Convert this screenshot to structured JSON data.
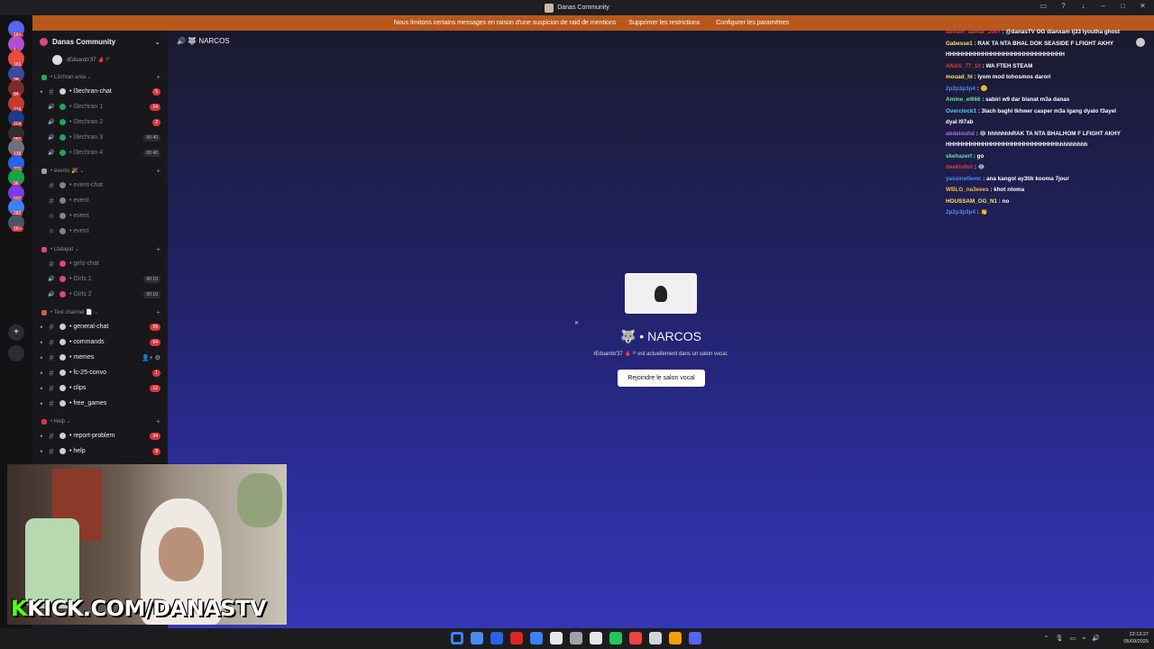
{
  "window": {
    "title": "Danas Community"
  },
  "banner": {
    "message": "Nous limitons certains messages en raison d'une suspicion de raid de mentions",
    "btn_remove": "Supprimer les restrictions",
    "btn_configure": "Configurer les paramètres"
  },
  "rail_badges": [
    "1K+",
    "1",
    "165",
    "38",
    "84",
    "210",
    "114",
    "267",
    "138",
    "721",
    "96",
    "507",
    "282",
    "1K+"
  ],
  "sidebar": {
    "server_name": "Danas Community",
    "voice_user": "ℓEduardo'37 🩸 ³⁷",
    "categories": [
      {
        "name": "L3chran area",
        "channels": [
          {
            "name": "l3echran-chat",
            "type": "text",
            "unread": true,
            "count": "5"
          },
          {
            "name": "l3echran 1",
            "type": "voice",
            "count": "14"
          },
          {
            "name": "l3echran 2",
            "type": "voice",
            "count": "2"
          },
          {
            "name": "l3echran 3",
            "type": "voice",
            "occ": "00 40"
          },
          {
            "name": "l3echran 4",
            "type": "voice",
            "occ": "00 40"
          }
        ]
      },
      {
        "name": "events 🎉",
        "channels": [
          {
            "name": "event-chat",
            "type": "text"
          },
          {
            "name": "event",
            "type": "text"
          },
          {
            "name": "event",
            "type": "stage"
          },
          {
            "name": "event",
            "type": "stage"
          }
        ]
      },
      {
        "name": "Lfatayat",
        "channels": [
          {
            "name": "girls-chat",
            "type": "text"
          },
          {
            "name": "Girls 1",
            "type": "voice",
            "occ": "00 10"
          },
          {
            "name": "Girls 2",
            "type": "voice",
            "occ": "00 10"
          }
        ]
      },
      {
        "name": "Text channel 📄",
        "channels": [
          {
            "name": "general-chat",
            "type": "text",
            "unread": true,
            "count": "99"
          },
          {
            "name": "commands",
            "type": "text",
            "unread": true,
            "count": "64"
          },
          {
            "name": "memes",
            "type": "text",
            "unread": true,
            "tools": "👤+ ⚙"
          },
          {
            "name": "fc-25-convo",
            "type": "text",
            "unread": true,
            "count": "1"
          },
          {
            "name": "clips",
            "type": "text",
            "unread": true,
            "count": "12"
          },
          {
            "name": "free_games",
            "type": "text",
            "unread": true
          }
        ]
      },
      {
        "name": "Help",
        "channels": [
          {
            "name": "report-problem",
            "type": "text",
            "unread": true,
            "count": "34"
          },
          {
            "name": "help",
            "type": "text",
            "unread": true,
            "count": "8"
          }
        ]
      }
    ]
  },
  "main": {
    "channel_title": "NARCOS",
    "voice_name": "NARCOS",
    "voice_sub": "ℓEduardo'37 🩸 ³⁷ est actuellement dans un salon vocal.",
    "join_label": "Rejoindre le salon vocal"
  },
  "chat": [
    {
      "user": "aboubr_aamar_2007",
      "color": "#e23b3b",
      "text": ": @danasTV OG dianxam ij33 lyoutha ghost"
    },
    {
      "user": "Gabesse1",
      "color": "#f5e663",
      "text": ": RAK TA NTA BHAL DOK SEASIDE F LFIGHT AKHY HHHHHHHHHHHHHHHHHHHHHHHHHHHHH"
    },
    {
      "user": "ANAS_77_10",
      "color": "#e23b3b",
      "text": ": WA FTEH STEAM"
    },
    {
      "user": "mouad_hl",
      "color": "#f5e663",
      "text": ": lyom mod tohosmos darori"
    },
    {
      "user": "2p2p3p3p4",
      "color": "#4c8ef5",
      "text": ": 🙂"
    },
    {
      "user": "Amine_el666",
      "color": "#6fe0a0",
      "text": ": sabiri w9 dar blanat m3a danas"
    },
    {
      "user": "Overclock1",
      "color": "#5fd1f0",
      "text": ": 3lach baghi tkhwer casper m3a lgang dyalo f3ayel dyal l97ab"
    },
    {
      "user": "abdelouhd",
      "color": "#b06cf0",
      "text": ": 😂 hhhhhhhRAK TA NTA BHALHOM F LFIGHT AKHY HHHHHHHHHHHHHHHHHHHHHHHHHHHhhhhhhhhh"
    },
    {
      "user": "skehazert",
      "color": "#6fe0a0",
      "text": ": go"
    },
    {
      "user": "deektofmt",
      "color": "#e23b3b",
      "text": ": 😂"
    },
    {
      "user": "yassinetlemc",
      "color": "#4c8ef5",
      "text": ": ana kangol ay3tik kooma 7jour"
    },
    {
      "user": "WBLG_na3eees",
      "color": "#f5b941",
      "text": ": khot ntoma"
    },
    {
      "user": "HOUSSAM_OG_N1",
      "color": "#f5e663",
      "text": ": no"
    },
    {
      "user": "2p2p3p3p4",
      "color": "#4c8ef5",
      "text": ": 👏"
    }
  ],
  "webcam": {
    "kick_k": "K",
    "kick_text": "KICK.COM/DANASTV"
  },
  "taskbar": {
    "time": "22:13:27",
    "date": "05/09/2025",
    "icon_colors": [
      "#3b82f6",
      "#4a8af0",
      "#2563eb",
      "#dc2626",
      "#3b82f6",
      "#e5e7eb",
      "#9ca3af",
      "#e5e7eb",
      "#22c55e",
      "#ef4444",
      "#d1d5db",
      "#f59e0b",
      "#5865f2"
    ]
  },
  "colors": {
    "banner": "#b8581c",
    "accent": "#5865f2",
    "kick_green": "#53fc18"
  }
}
